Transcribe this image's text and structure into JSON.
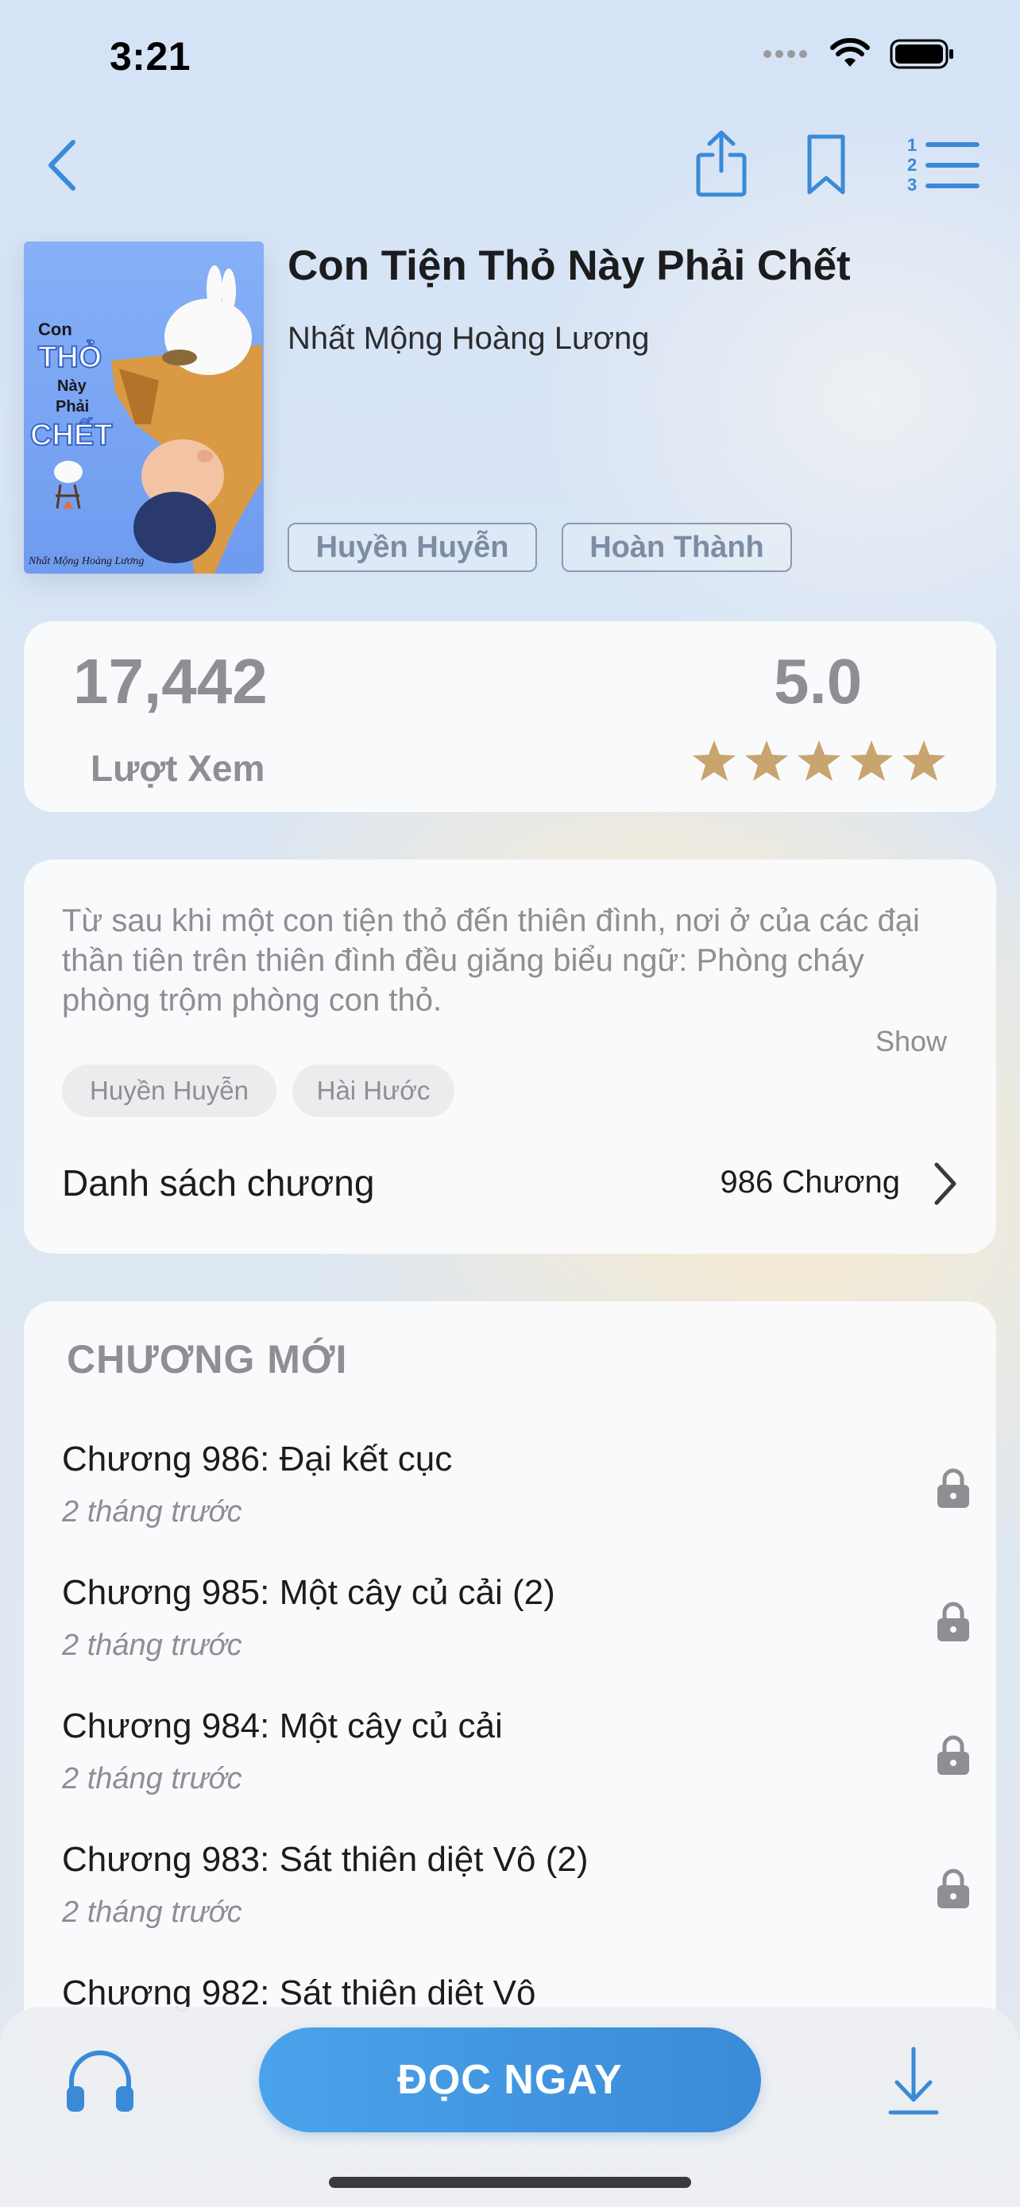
{
  "status_bar": {
    "time": "3:21"
  },
  "nav": {
    "back_icon": "chevron-left-icon",
    "share_icon": "share-icon",
    "bookmark_icon": "bookmark-icon",
    "chapters_icon": "numbered-list-icon"
  },
  "book": {
    "title": "Con Tiện Thỏ Này Phải Chết",
    "author": "Nhất Mộng Hoàng Lương",
    "genre": "Huyền Huyễn",
    "status": "Hoàn Thành",
    "cover": {
      "line1": "Con",
      "line2": "THỎ",
      "line3": "Này",
      "line4": "Phải",
      "line5": "CHẾT",
      "footer": "Nhất Mộng Hoàng Lương"
    }
  },
  "stats": {
    "views": "17,442",
    "views_label": "Lượt Xem",
    "rating": "5.0",
    "stars": 5
  },
  "info": {
    "description": "Từ sau khi một con tiện thỏ đến thiên đình, nơi ở của các đại thần tiên trên thiên đình đều giăng biểu ngữ: Phòng cháy phòng trộm phòng con thỏ.",
    "show_label": "Show",
    "tags": [
      "Huyền Huyễn",
      "Hài Hước"
    ],
    "toc_label": "Danh sách chương",
    "toc_count": "986 Chương"
  },
  "new_chapters": {
    "title": "CHƯƠNG MỚI",
    "items": [
      {
        "title": "Chương 986: Đại kết cục",
        "time": "2 tháng trước"
      },
      {
        "title": "Chương 985: Một cây củ cải (2)",
        "time": "2 tháng trước"
      },
      {
        "title": "Chương 984: Một cây củ cải",
        "time": "2 tháng trước"
      },
      {
        "title": "Chương 983: Sát thiên diệt Vô (2)",
        "time": "2 tháng trước"
      },
      {
        "title": "Chương 982: Sát thiên diệt Vô",
        "time": ""
      }
    ]
  },
  "bottom_bar": {
    "read_label": "ĐỌC NGAY",
    "audio_icon": "headphones-icon",
    "download_icon": "download-icon"
  },
  "colors": {
    "accent": "#3a8ad8",
    "star": "#c8a46e",
    "muted": "#8e8e93"
  }
}
